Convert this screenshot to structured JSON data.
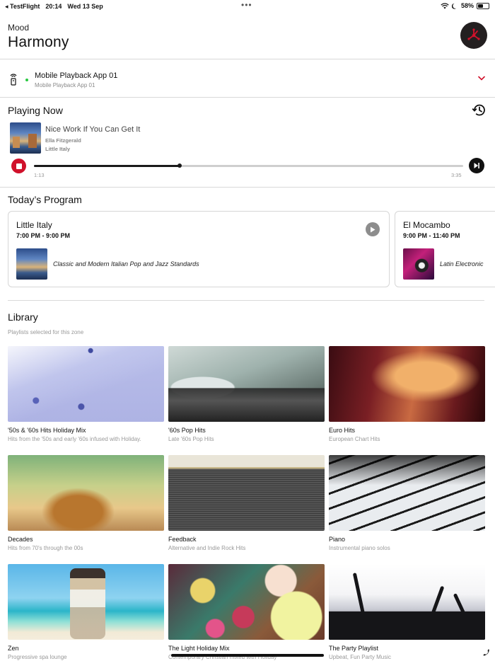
{
  "status_bar": {
    "back_app": "◂ TestFlight",
    "time": "20:14",
    "date": "Wed 13 Sep",
    "battery": "58%",
    "battery_level": 0.58
  },
  "header": {
    "eyebrow": "Mood",
    "title": "Harmony",
    "logo_icon": "brand-logo-icon",
    "accent_color": "#d0112b"
  },
  "zone": {
    "name": "Mobile Playback App 01",
    "subtitle": "Mobile Playback App 01",
    "status_color": "#28c840"
  },
  "playing_now": {
    "section_title": "Playing Now",
    "track_title": "Nice Work If You Can Get It",
    "artist": "Ella Fitzgerald",
    "album": "Little Italy",
    "elapsed": "1:13",
    "duration": "3:35",
    "progress": 0.34
  },
  "program": {
    "section_title": "Today’s Program",
    "items": [
      {
        "name": "Little Italy",
        "time": "7:00 PM - 9:00 PM",
        "description": "Classic and Modern Italian Pop and Jazz Standards"
      },
      {
        "name": "El Mocambo",
        "time": "9:00 PM - 11:40 PM",
        "description": "Latin Electronic"
      }
    ]
  },
  "library": {
    "section_title": "Library",
    "subtitle": "Playlists selected for this zone",
    "playlists": [
      {
        "name": "'50s & '60s Hits Holiday Mix",
        "description": "Hits from the '50s and early '60s infused with Holiday."
      },
      {
        "name": "'60s Pop Hits",
        "description": "Late '60s Pop Hits"
      },
      {
        "name": "Euro Hits",
        "description": "European Chart Hits"
      },
      {
        "name": "Decades",
        "description": "Hits from 70's through the 00s"
      },
      {
        "name": "Feedback",
        "description": "Alternative and Indie Rock Hits"
      },
      {
        "name": "Piano",
        "description": "Instrumental piano solos"
      },
      {
        "name": "Zen",
        "description": "Progressive spa lounge"
      },
      {
        "name": "The Light Holiday Mix",
        "description": "Contemporary Christian mixed with Holiday"
      },
      {
        "name": "The Party Playlist",
        "description": "Upbeat, Fun Party Music"
      }
    ]
  }
}
